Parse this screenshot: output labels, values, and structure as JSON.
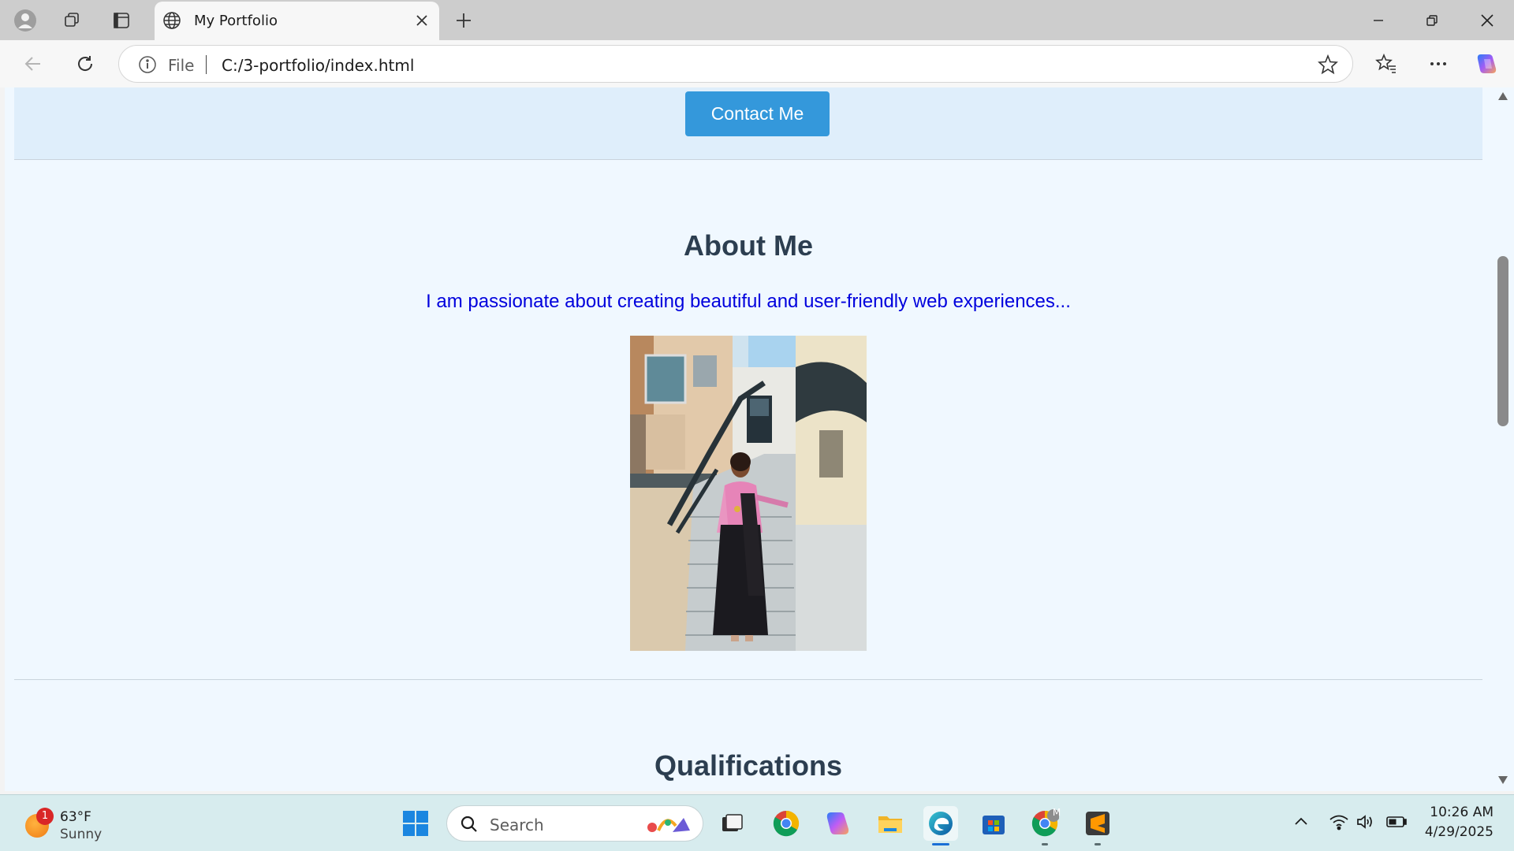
{
  "browser": {
    "tab": {
      "title": "My Portfolio",
      "favicon": "globe-icon"
    },
    "address": {
      "scheme": "File",
      "url": "C:/3-portfolio/index.html"
    }
  },
  "page": {
    "contact_button": "Contact Me",
    "about": {
      "heading": "About Me",
      "text": "I am passionate about creating beautiful and user-friendly web experiences..."
    },
    "qualifications_heading": "Qualifications"
  },
  "taskbar": {
    "weather": {
      "temp": "63°F",
      "condition": "Sunny",
      "badge": "1"
    },
    "search_label": "Search",
    "clock": {
      "time": "10:26 AM",
      "date": "4/29/2025"
    },
    "chrome_profile_badge": "M"
  },
  "colors": {
    "accent_button": "#3498db",
    "heading": "#2c3e50",
    "about_text": "#0000dd",
    "page_background": "#f0f8ff"
  }
}
